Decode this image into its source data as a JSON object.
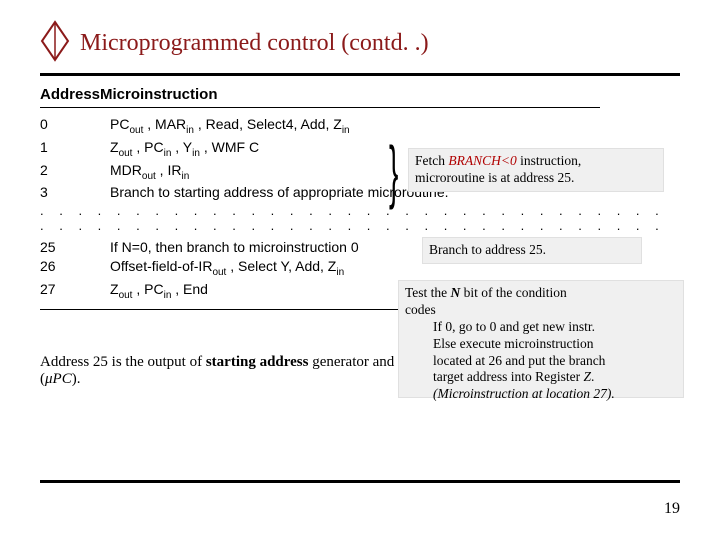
{
  "title": "Microprogrammed control (contd. .)",
  "header": {
    "col1": "Address",
    "col2": "Microinstruction"
  },
  "rows": [
    {
      "addr": "0",
      "instr": "PC<sub>out</sub> , MAR<sub>in</sub> , Read, Select4, Add, Z<sub>in</sub>"
    },
    {
      "addr": "1",
      "instr": "Z<sub>out</sub> , PC<sub>in</sub> , Y<sub>in</sub> , WMF C"
    },
    {
      "addr": "2",
      "instr": "MDR<sub>out</sub> , IR<sub>in</sub>"
    },
    {
      "addr": "3",
      "instr": "Branch to starting address of appropriate microroutine."
    },
    {
      "addr": "25",
      "instr": "If N=0, then branch to microinstruction 0"
    },
    {
      "addr": "26",
      "instr": "Offset-field-of-IR<sub>out</sub> , Select Y, Add, Z<sub>in</sub>"
    },
    {
      "addr": "27",
      "instr": "Z<sub>out</sub> , PC<sub>in</sub> , End"
    }
  ],
  "dots": ". . . . . . . . . . . . . . . . . . . . . . . . . . . . . . . . . . . . . . . . . . . . . . . . . . . . . . . . . . . . . . . . . .",
  "annot1": {
    "l1a": "Fetch ",
    "l1b": "BRANCH<0",
    "l1c": " instruction,",
    "l2": "microroutine is at address 25."
  },
  "annot2": {
    "text": "Branch to address 25."
  },
  "annot3": {
    "l1a": "Test the ",
    "l1b": "N",
    "l1c": " bit of the condition",
    "l2": "codes",
    "l3": "If 0, go to 0 and get new instr.",
    "l4": "Else execute microinstruction",
    "l5": "located at 26 and put the branch",
    "l6a": "target address into Register ",
    "l6b": "Z",
    "l6c": ".",
    "l7": "(Microinstruction at location 27)."
  },
  "bodytext": {
    "pre": "Address 25 is the output of ",
    "b1": "starting address",
    "mid": " generator and is loaded into the microprogram counter (",
    "mpc": "μPC",
    "post": ")."
  },
  "pagenum": "19",
  "icon": "diamond-icon"
}
